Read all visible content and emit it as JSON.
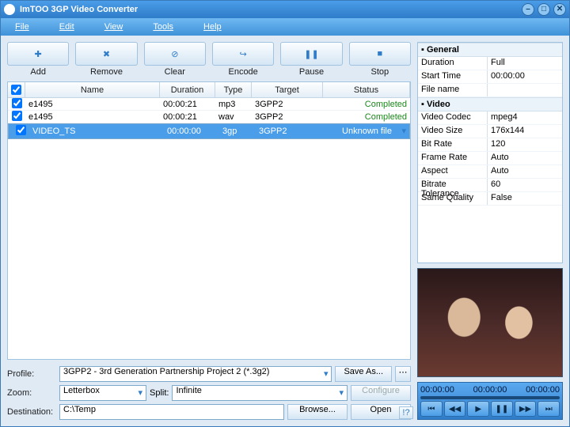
{
  "window": {
    "title": "ImTOO 3GP Video Converter"
  },
  "menu": [
    "File",
    "Edit",
    "View",
    "Tools",
    "Help"
  ],
  "toolbar": {
    "add": {
      "label": "Add",
      "glyph": "✚"
    },
    "remove": {
      "label": "Remove",
      "glyph": "✖"
    },
    "clear": {
      "label": "Clear",
      "glyph": "⊘"
    },
    "encode": {
      "label": "Encode",
      "glyph": "↪"
    },
    "pause": {
      "label": "Pause",
      "glyph": "❚❚"
    },
    "stop": {
      "label": "Stop",
      "glyph": "■"
    }
  },
  "grid": {
    "headers": {
      "name": "Name",
      "duration": "Duration",
      "type": "Type",
      "target": "Target",
      "status": "Status"
    },
    "rows": [
      {
        "checked": true,
        "name": "e1495",
        "duration": "00:00:21",
        "type": "mp3",
        "target": "3GPP2",
        "status": "Completed",
        "sel": false
      },
      {
        "checked": true,
        "name": "e1495",
        "duration": "00:00:21",
        "type": "wav",
        "target": "3GPP2",
        "status": "Completed",
        "sel": false
      },
      {
        "checked": true,
        "name": "VIDEO_TS",
        "duration": "00:00:00",
        "type": "3gp",
        "target": "3GPP2",
        "status": "Unknown file",
        "sel": true
      }
    ]
  },
  "bottom": {
    "profile_label": "Profile:",
    "profile_value": "3GPP2 - 3rd Generation Partnership Project 2  (*.3g2)",
    "saveas": "Save As...",
    "zoom_label": "Zoom:",
    "zoom_value": "Letterbox",
    "split_label": "Split:",
    "split_value": "Infinite",
    "configure": "Configure",
    "destination_label": "Destination:",
    "destination_value": "C:\\Temp",
    "browse": "Browse...",
    "open": "Open"
  },
  "props": {
    "groups": [
      {
        "title": "General",
        "rows": [
          {
            "k": "Duration",
            "v": "Full"
          },
          {
            "k": "Start Time",
            "v": "00:00:00"
          },
          {
            "k": "File name",
            "v": ""
          }
        ]
      },
      {
        "title": "Video",
        "rows": [
          {
            "k": "Video Codec",
            "v": "mpeg4"
          },
          {
            "k": "Video Size",
            "v": "176x144"
          },
          {
            "k": "Bit Rate",
            "v": "120"
          },
          {
            "k": "Frame Rate",
            "v": "Auto"
          },
          {
            "k": "Aspect",
            "v": "Auto"
          },
          {
            "k": "Bitrate Tolerance",
            "v": "60"
          },
          {
            "k": "Same Quality",
            "v": "False"
          }
        ]
      }
    ]
  },
  "player": {
    "t1": "00:00:00",
    "t2": "00:00:00",
    "t3": "00:00:00",
    "btns": [
      "⏮",
      "◀◀",
      "▶",
      "❚❚",
      "▶▶",
      "⏭"
    ]
  }
}
